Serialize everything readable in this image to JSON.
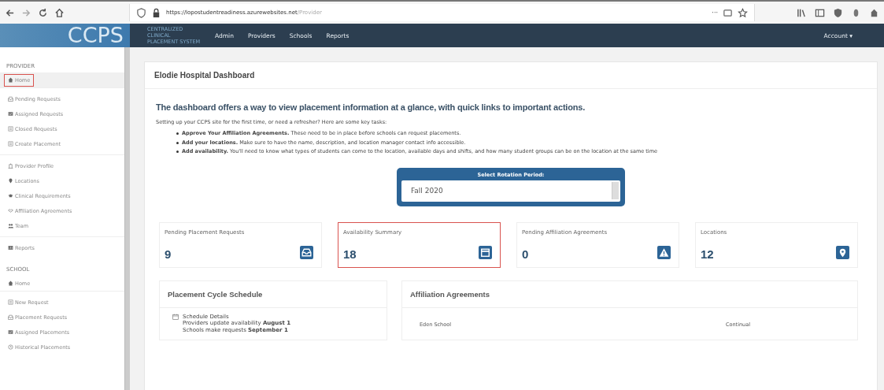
{
  "browser": {
    "url_host": "https://lopostudentreadiness.azurewebsites.net",
    "url_path": "/Provider",
    "page_actions": "···"
  },
  "navbar": {
    "logo": "CCPS",
    "tagline": "CENTRALIZED CLINICAL PLACEMENT SYSTEM",
    "menu": [
      "Admin",
      "Providers",
      "Schools",
      "Reports"
    ],
    "account": "Account ▾"
  },
  "sidebar": {
    "sections": [
      {
        "heading": "PROVIDER",
        "groups": [
          [
            {
              "label": "Home",
              "highlighted": true
            }
          ],
          [
            {
              "label": "Pending Requests",
              "highlighted": false
            },
            {
              "label": "Assigned Requests",
              "highlighted": false
            },
            {
              "label": "Closed Requests",
              "highlighted": false
            },
            {
              "label": "Create Placement",
              "highlighted": false
            }
          ],
          [
            {
              "label": "Provider Profile",
              "highlighted": false
            },
            {
              "label": "Locations",
              "highlighted": false
            },
            {
              "label": "Clinical Requirements",
              "highlighted": false
            },
            {
              "label": "Affiliation Agreements",
              "highlighted": false
            },
            {
              "label": "Team",
              "highlighted": false
            }
          ],
          [
            {
              "label": "Reports",
              "highlighted": false
            }
          ]
        ]
      },
      {
        "heading": "SCHOOL",
        "groups": [
          [
            {
              "label": "Home",
              "highlighted": false
            }
          ],
          [
            {
              "label": "New Request",
              "highlighted": false
            },
            {
              "label": "Placement Requests",
              "highlighted": false
            },
            {
              "label": "Assigned Placements",
              "highlighted": false
            },
            {
              "label": "Historical Placements",
              "highlighted": false
            }
          ]
        ]
      }
    ]
  },
  "dashboard": {
    "title": "Elodie Hospital Dashboard",
    "heading": "The dashboard offers a way to view placement information at a glance, with quick links to important actions.",
    "intro": "Setting up your CCPS site for the first time, or need a refresher? Here are some key tasks:",
    "tasks": [
      "**Approve Your Affiliation Agreements.** These need to be in place before schools can request placements.",
      "**Add your locations.** Make sure to have the name, description, and location manager contact info accessible.",
      "**Add availability.** You'll need to know what types of students can come to the location, available days and shifts, and how many student groups can be on the location at the same time"
    ],
    "rotation": {
      "label": "Select Rotation Period:",
      "value": "Fall 2020"
    },
    "stats": [
      {
        "label": "Pending Placement Requests",
        "value": "9",
        "highlighted": false
      },
      {
        "label": "Availability Summary",
        "value": "18",
        "highlighted": true
      },
      {
        "label": "Pending Affiliation Agreements",
        "value": "0",
        "highlighted": false
      },
      {
        "label": "Locations",
        "value": "12",
        "highlighted": false
      }
    ],
    "schedule": {
      "title": "Placement Cycle Schedule",
      "details_title": "Schedule Details",
      "lines": [
        "Providers update availability **August 1**",
        "Schools make requests **September 1**"
      ]
    },
    "agreements": {
      "title": "Affiliation Agreements",
      "rows": [
        {
          "school": "Eden School",
          "term": "Continual"
        }
      ]
    }
  }
}
